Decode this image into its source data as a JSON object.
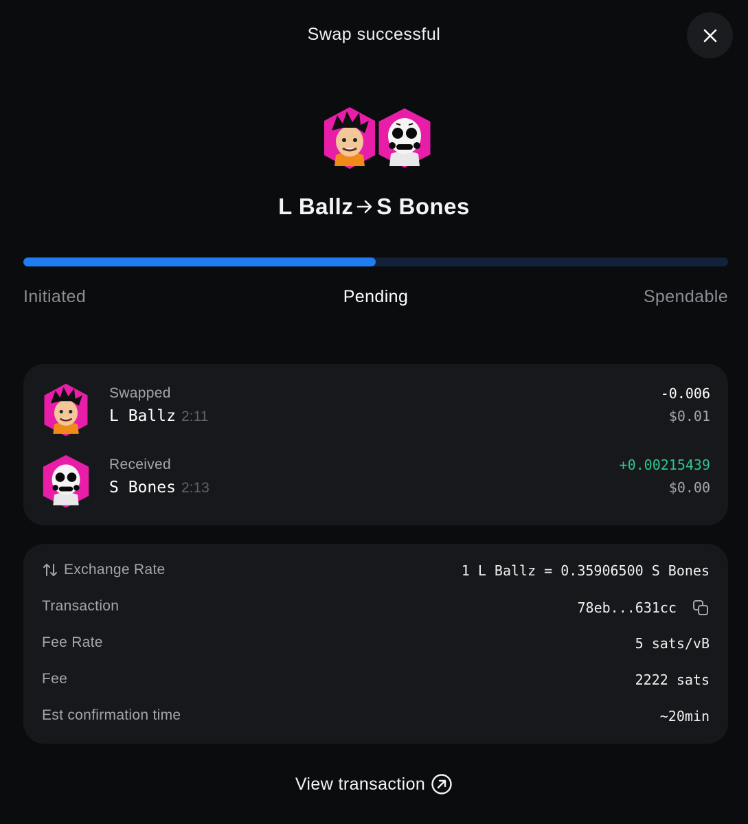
{
  "header": {
    "title": "Swap successful"
  },
  "hero": {
    "from": "L Ballz",
    "to": "S Bones"
  },
  "progress": {
    "fraction": 0.5,
    "steps": [
      "Initiated",
      "Pending",
      "Spendable"
    ],
    "current": "Pending"
  },
  "activity": [
    {
      "label": "Swapped",
      "name": "L Ballz",
      "time": "2:11",
      "amount": "-0.006",
      "usd": "$0.01",
      "icon": "l-ballz-avatar"
    },
    {
      "label": "Received",
      "name": "S Bones",
      "time": "2:13",
      "amount": "+0.00215439",
      "usd": "$0.00",
      "icon": "s-bones-avatar"
    }
  ],
  "details": {
    "exchange_rate": {
      "label": "Exchange Rate",
      "value": "1 L Ballz = 0.35906500 S Bones"
    },
    "transaction": {
      "label": "Transaction",
      "value": "78eb...631cc"
    },
    "fee_rate": {
      "label": "Fee Rate",
      "value": "5 sats/vB"
    },
    "fee": {
      "label": "Fee",
      "value": "2222 sats"
    },
    "est_time": {
      "label": "Est confirmation time",
      "value": "~20min"
    }
  },
  "footer": {
    "view_label": "View transaction"
  },
  "colors": {
    "accent": "#1f7cf3",
    "positive": "#30c48d",
    "avatar_bg": "#e91ea8"
  }
}
